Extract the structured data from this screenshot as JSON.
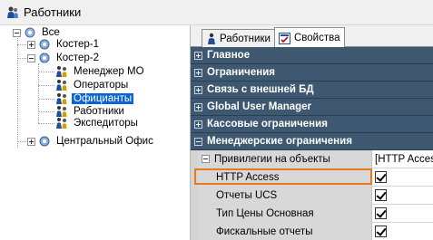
{
  "window": {
    "title": "Работники"
  },
  "tree": {
    "root": "Все",
    "nodes": [
      {
        "label": "Костер-1"
      },
      {
        "label": "Костер-2",
        "children": [
          {
            "label": "Менеджер МО"
          },
          {
            "label": "Операторы"
          },
          {
            "label": "Официанты",
            "selected": true
          },
          {
            "label": "Работники"
          },
          {
            "label": "Экспедиторы"
          }
        ]
      },
      {
        "label": "Центральный Офис"
      }
    ]
  },
  "tabs": [
    {
      "label": "Работники"
    },
    {
      "label": "Свойства",
      "active": true
    }
  ],
  "categories": [
    "Главное",
    "Ограничения",
    "Связь с внешней БД",
    "Global User Manager",
    "Кассовые ограничения",
    "Менеджерские ограничения"
  ],
  "properties": {
    "group_name": "Привилегии на объекты",
    "group_value": "[HTTP Access",
    "items": [
      {
        "name": "HTTP Access",
        "checked": true
      },
      {
        "name": "Отчеты UCS",
        "checked": true
      },
      {
        "name": "Тип Цены Основная",
        "checked": true
      },
      {
        "name": "Фискальные отчеты",
        "checked": true
      }
    ]
  },
  "colors": {
    "category_bg": "#3e5872",
    "selection": "#0a64d8",
    "highlight": "#e87a1a"
  }
}
